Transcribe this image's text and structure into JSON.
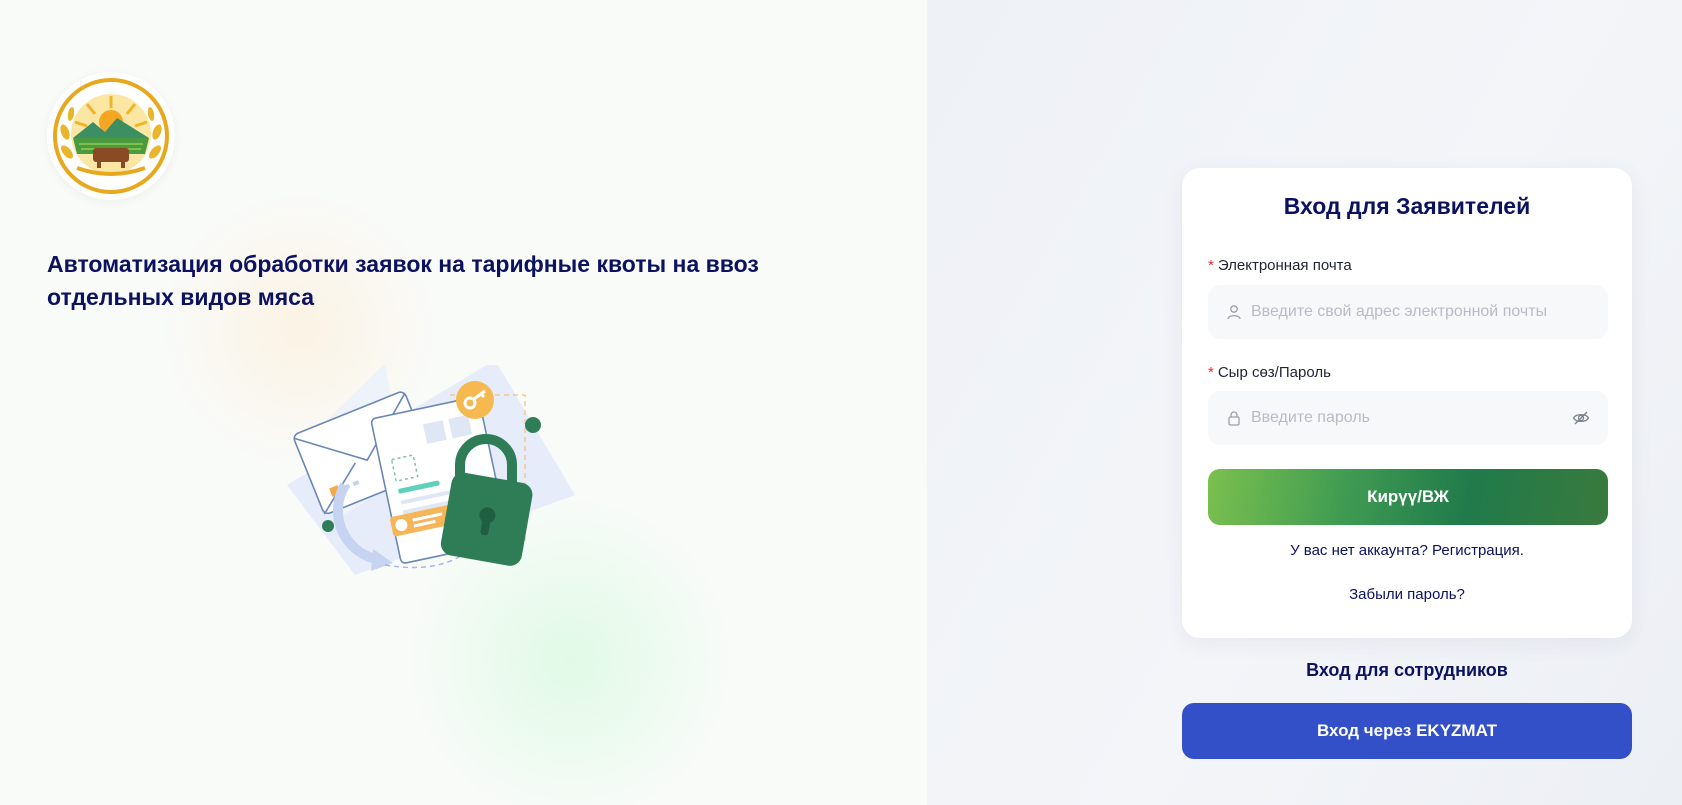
{
  "page": {
    "subtitle": "Автоматизация обработки заявок на тарифные квоты на ввоз отдельных видов мяса"
  },
  "logo": {
    "icon": "emblem-logo"
  },
  "illustration": {
    "icon": "secure-documents-lock-illustration"
  },
  "login_card": {
    "title": "Вход для Заявителей",
    "email": {
      "label": "Электронная почта",
      "required_mark": "*",
      "value": "",
      "placeholder": "Введите свой адрес электронной почты",
      "icon": "user-icon"
    },
    "password": {
      "label": "Сыр сөз/Пароль",
      "required_mark": "*",
      "value": "",
      "placeholder": "Введите пароль",
      "icon": "lock-icon",
      "toggle_icon": "eye-off-icon"
    },
    "submit_label": "Кирүү/ВЖ",
    "register_link": "У вас нет аккаунта? Регистрация.",
    "forgot_link": "Забыли пароль?"
  },
  "staff": {
    "label": "Вход для сотрудников",
    "button_label": "Вход через EKYZMAT"
  },
  "colors": {
    "navy": "#0c1160",
    "green_start": "#7bc04f",
    "green_end": "#207a4b",
    "blue_button": "#3350c9",
    "required": "#ef2b2b"
  }
}
